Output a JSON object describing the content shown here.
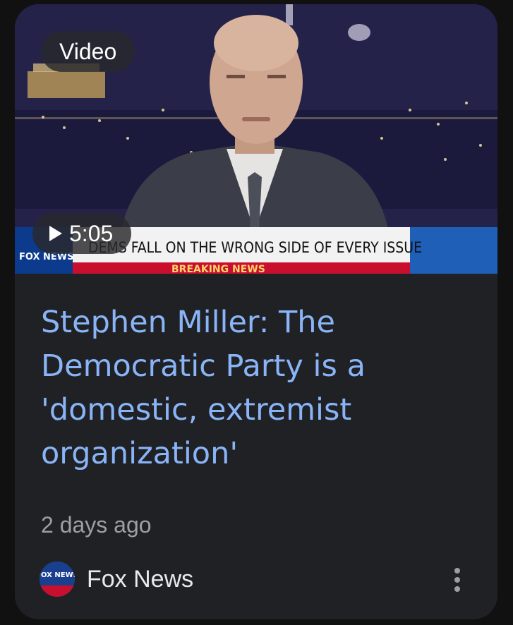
{
  "card": {
    "thumbnail": {
      "badge_label": "Video",
      "duration": "5:05",
      "chyron_text": "DEMS FALL ON THE WRONG SIDE OF EVERY ISSUE",
      "ticker_text": "BREAKING NEWS",
      "network_logo_text": "FOX NEWS"
    },
    "title": "Stephen Miller: The Democratic Party is a 'domestic, extremist organization'",
    "published": "2 days ago",
    "source": {
      "name": "Fox News",
      "logo_text": "FOX NEWS"
    },
    "more_icon": "more-vert-icon"
  },
  "colors": {
    "card_background": "#202124",
    "title": "#8ab4f8",
    "secondary_text": "#9aa0a6",
    "source_text": "#e8eaed"
  }
}
